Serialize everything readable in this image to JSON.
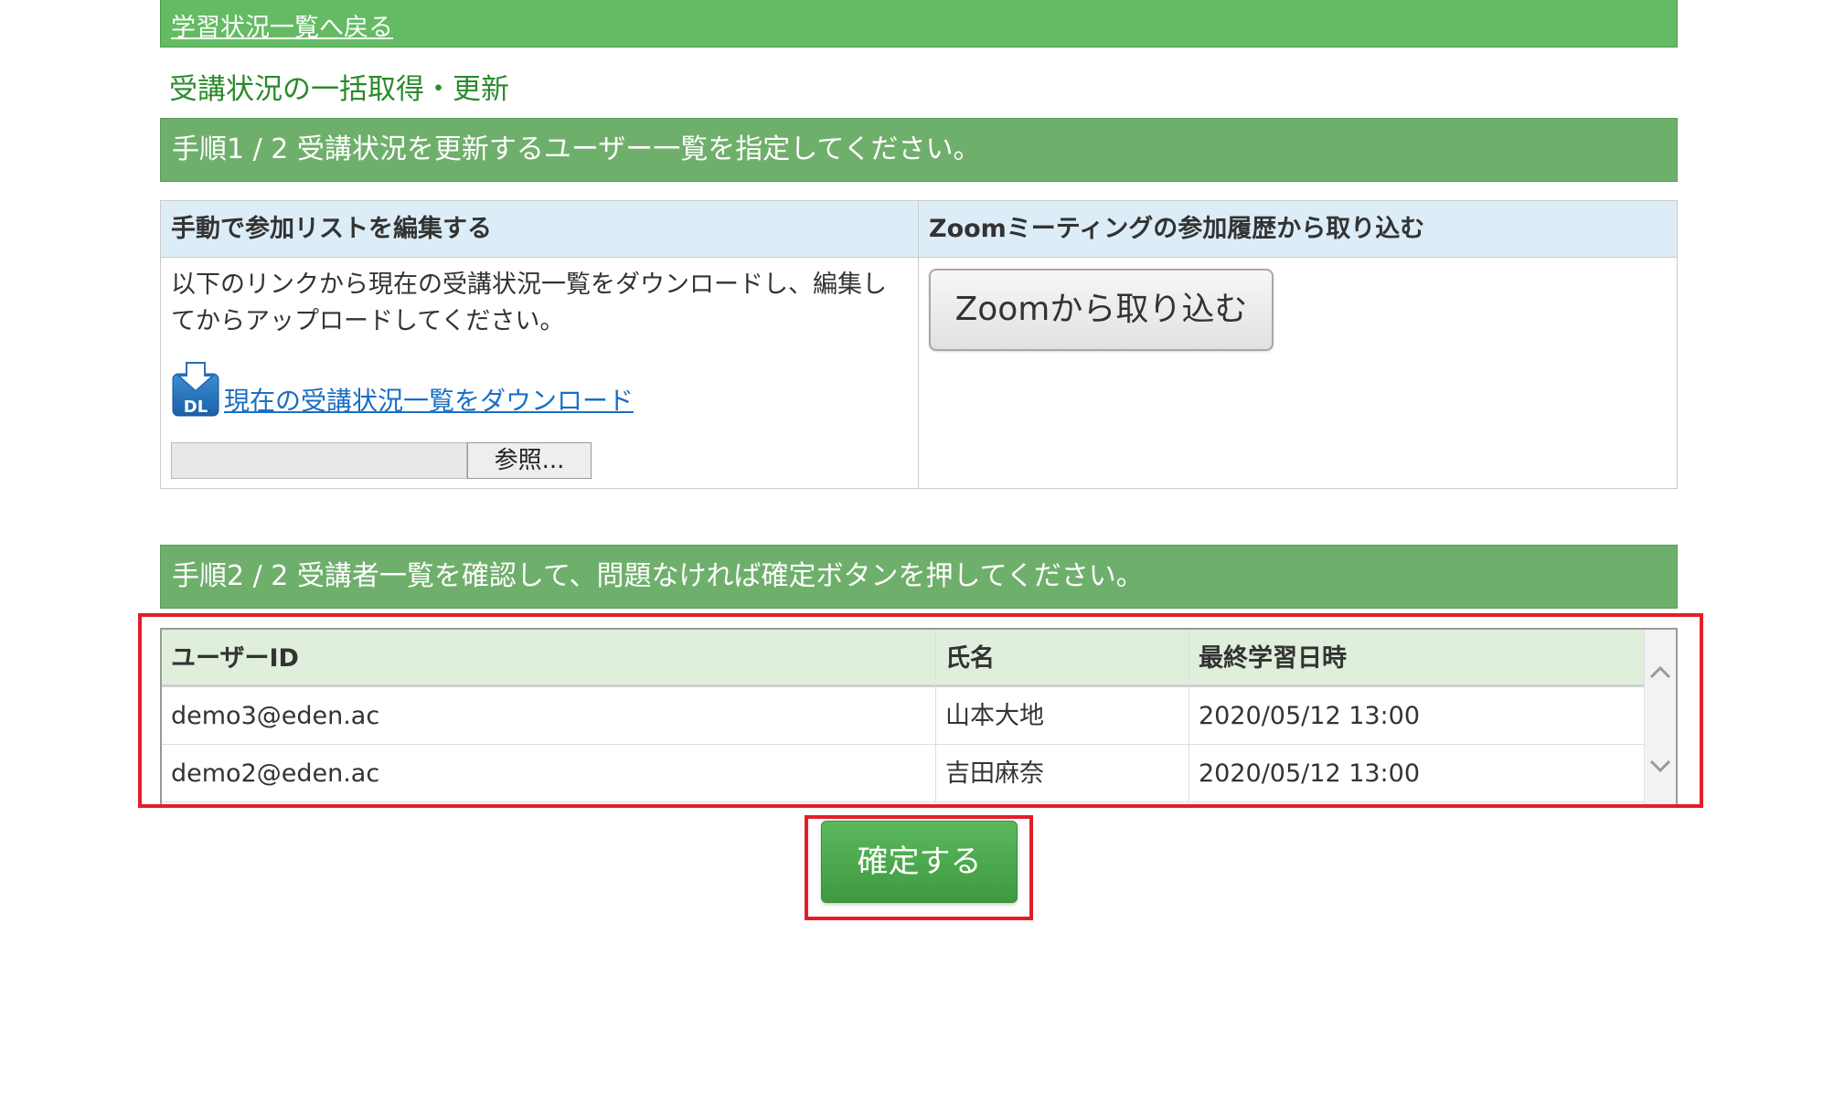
{
  "nav": {
    "back_link": "学習状況一覧へ戻る"
  },
  "page": {
    "title": "受講状況の一括取得・更新"
  },
  "step1": {
    "header": "手順1 / 2 受講状況を更新するユーザー一覧を指定してください。",
    "manual": {
      "heading": "手動で参加リストを編集する",
      "instructions": "以下のリンクから現在の受講状況一覧をダウンロードし、編集してからアップロードしてください。",
      "dl_icon_label": "DL",
      "download_link": "現在の受講状況一覧をダウンロード",
      "browse_button": "参照..."
    },
    "zoom": {
      "heading": "Zoomミーティングの参加履歴から取り込む",
      "import_button": "Zoomから取り込む"
    }
  },
  "step2": {
    "header": "手順2 / 2 受講者一覧を確認して、問題なければ確定ボタンを押してください。",
    "table": {
      "columns": [
        "ユーザーID",
        "氏名",
        "最終学習日時"
      ],
      "rows": [
        {
          "user_id": "demo3@eden.ac",
          "name": "山本大地",
          "last_study": "2020/05/12 13:00"
        },
        {
          "user_id": "demo2@eden.ac",
          "name": "吉田麻奈",
          "last_study": "2020/05/12 13:00"
        }
      ]
    },
    "confirm_button": "確定する"
  },
  "colors": {
    "header_green": "#6faf6c",
    "back_bar_green": "#64bb64",
    "title_green": "#2b8a2b",
    "link_blue": "#1a6fc4",
    "highlight_red": "#e31e2a",
    "column_head_blue": "#dcedf7",
    "table_head_green": "#dfefdb"
  }
}
